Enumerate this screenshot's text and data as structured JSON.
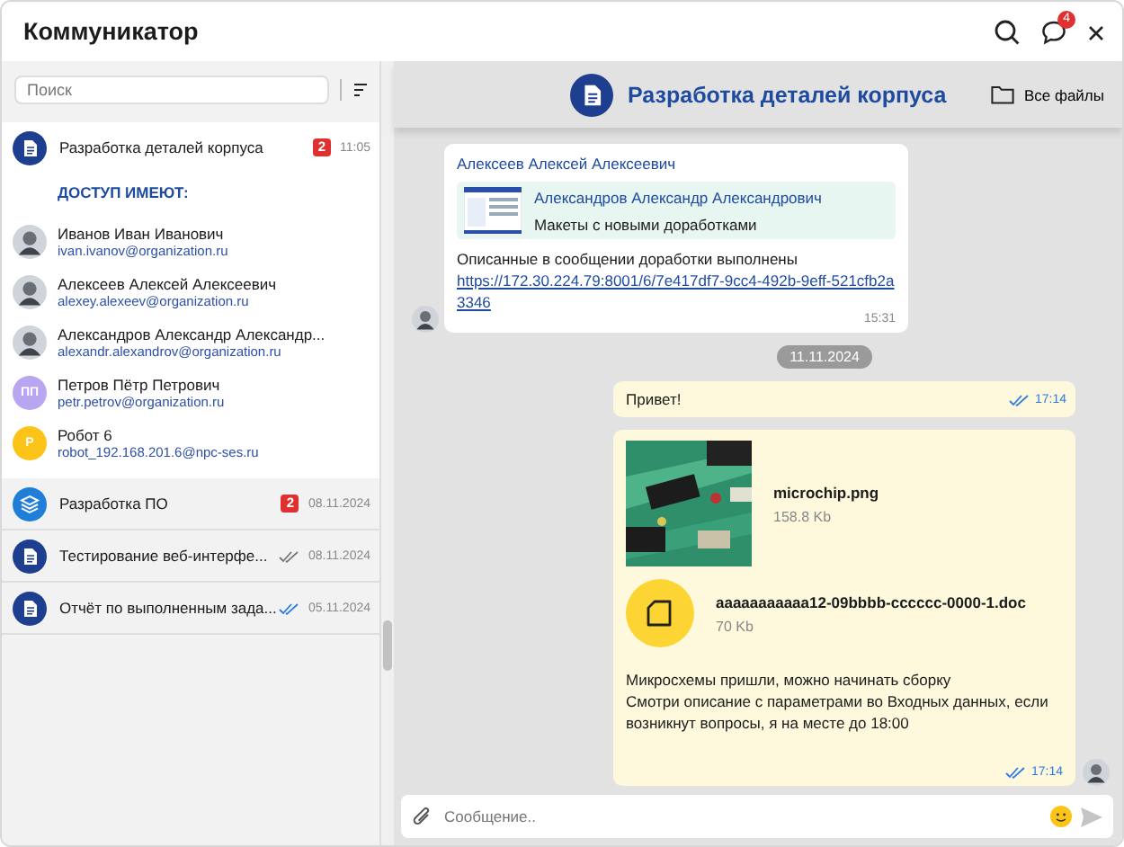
{
  "window": {
    "title": "Коммуникатор",
    "notifications": "4"
  },
  "search": {
    "placeholder": "Поиск"
  },
  "chats": [
    {
      "title": "Разработка деталей корпуса",
      "kind": "document",
      "selected": true,
      "unread": "2",
      "time": "11:05",
      "access_label": "ДОСТУП ИМЕЮТ:",
      "members": [
        {
          "name": "Иванов Иван Иванович",
          "email": "ivan.ivanov@organization.ru"
        },
        {
          "name": "Алексеев Алексей Алексеевич",
          "email": "alexey.alexeev@organization.ru"
        },
        {
          "name": "Александров Александр Александр...",
          "email": "alexandr.alexandrov@organization.ru"
        },
        {
          "name": "Петров Пётр Петрович",
          "email": "petr.petrov@organization.ru",
          "kind": "initials",
          "initials": "ПП",
          "color": "#b9a6f0"
        },
        {
          "name": "Робот 6",
          "email": "robot_192.168.201.6@npc-ses.ru",
          "kind": "initials",
          "initials": "Р",
          "color": "#fcc419"
        }
      ]
    },
    {
      "title": "Разработка ПО",
      "kind": "stack",
      "selected": false,
      "unread": "2",
      "time": "08.11.2024"
    },
    {
      "title": "Тестирование веб-интерфе...",
      "kind": "document",
      "selected": false,
      "time": "08.11.2024",
      "read": false
    },
    {
      "title": "Отчёт по выполненным зада...",
      "kind": "document",
      "selected": false,
      "time": "05.11.2024",
      "read": true
    }
  ],
  "conversation": {
    "title": "Разработка деталей корпуса",
    "files_button": "Все файлы"
  },
  "messages": [
    {
      "kind": "incoming",
      "author": "Алексеев Алексей Алексеевич",
      "quote": {
        "author": "Александров Александр Александрович",
        "text": "Макеты с новыми доработками"
      },
      "text": "Описанные в сообщении доработки выполнены",
      "link": "https://172.30.224.79:8001/6/7e417df7-9cc4-492b-9eff-521cfb2a3346",
      "time": "15:31"
    },
    {
      "kind": "date",
      "text": "11.11.2024"
    },
    {
      "kind": "outgoing",
      "text": "Привет!",
      "time": "17:14",
      "read": true
    },
    {
      "kind": "outgoing",
      "attachments": [
        {
          "name": "microchip.png",
          "size": "158.8 Kb"
        },
        {
          "kind": "file",
          "name": "aaaaaaaaaaa12-09bbbb-cccccc-0000-1.doc",
          "size": "70 Kb"
        }
      ],
      "lines": [
        "Микросхемы пришли, можно начинать сборку",
        "Смотри описание с параметрами во Входных данных, если возникнут вопросы, я на месте до 18:00"
      ],
      "time": "17:14",
      "read": true,
      "avatar": true
    }
  ],
  "composer": {
    "placeholder": "Сообщение.."
  }
}
